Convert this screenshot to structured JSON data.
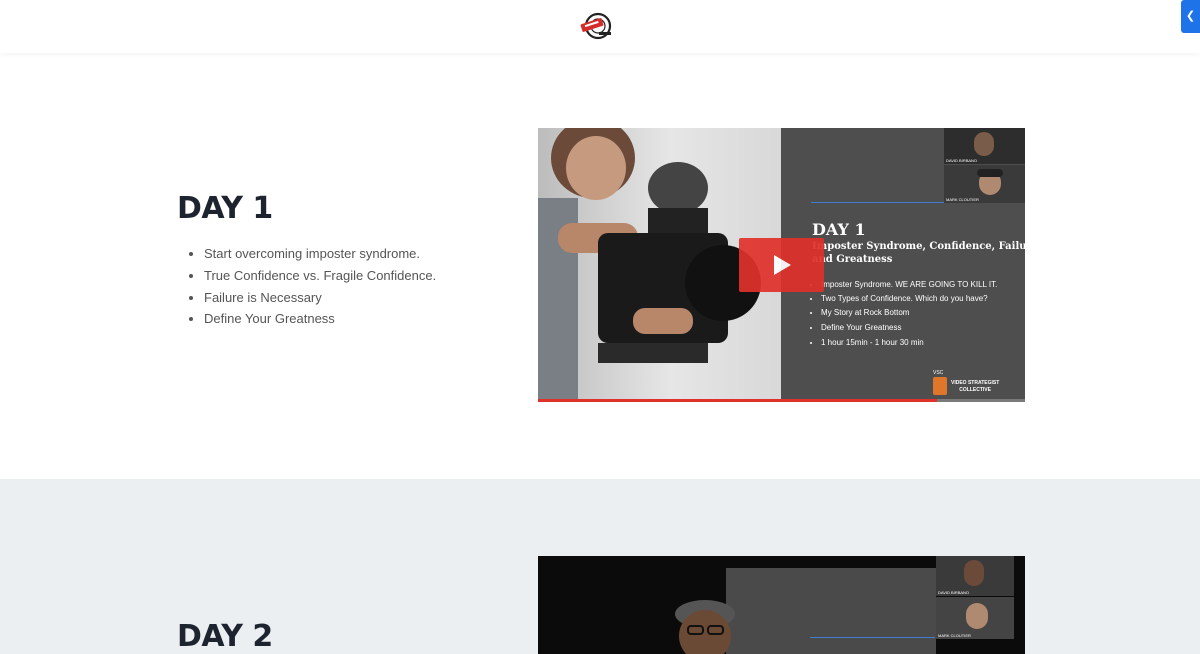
{
  "header": {
    "logo_icon": "brand-logo-icon",
    "side_toggle_icon": "chevron-left-icon"
  },
  "day1": {
    "title": "DAY 1",
    "bullets": [
      "Start overcoming imposter syndrome.",
      "True Confidence vs. Fragile Confidence.",
      "Failure is Necessary",
      "Define Your Greatness"
    ],
    "video": {
      "slide_title": "DAY 1",
      "slide_subtitle_line1": "Imposter Syndrome, Confidence, Failure",
      "slide_subtitle_line2": "and Greatness",
      "slide_bullets": [
        "Imposter Syndrome.  WE ARE GOING TO KILL IT.",
        "Two Types of Confidence. Which do you have?",
        "My Story at Rock Bottom",
        "Define Your Greatness",
        "1 hour 15min - 1 hour 30 min"
      ],
      "participant_1": "DAVID BIRBANO",
      "participant_2": "MARK CLOUTIER",
      "brand_mark": "VSC",
      "brand_text_line1": "VIDEO STRATEGIST",
      "brand_text_line2": "COLLECTIVE",
      "play_icon": "play-icon",
      "progress": 0.82
    }
  },
  "day2": {
    "title": "DAY 2",
    "video": {
      "participant_1": "DAVID BIRBANO",
      "participant_2": "MARK CLOUTIER"
    }
  },
  "colors": {
    "accent": "#1e73e8",
    "play_red": "#e0312b",
    "slide_bg": "#4e4e4e",
    "section_alt_bg": "#eceff1"
  }
}
